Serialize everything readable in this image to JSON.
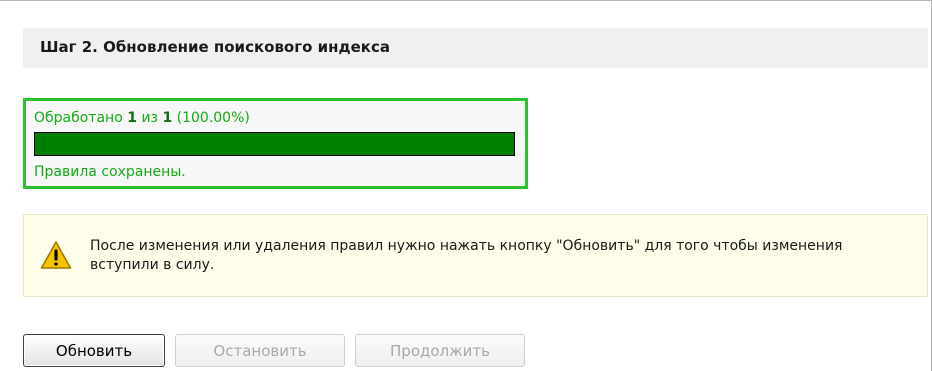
{
  "step": {
    "title": "Шаг 2. Обновление поискового индекса"
  },
  "progress": {
    "label_prefix": "Обработано",
    "processed": "1",
    "label_of": "из",
    "total": "1",
    "percent_text": "(100.00%)",
    "fraction": 1.0,
    "status": "Правила сохранены.",
    "colors": {
      "text": "#15a915",
      "fill": "#008000",
      "border": "#2cc12c"
    }
  },
  "notice": {
    "icon": "warning-icon",
    "text": "После изменения или удаления правил нужно нажать кнопку \"Обновить\" для того чтобы изменения вступили в силу."
  },
  "buttons": {
    "update_label": "Обновить",
    "stop_label": "Остановить",
    "continue_label": "Продолжить"
  }
}
